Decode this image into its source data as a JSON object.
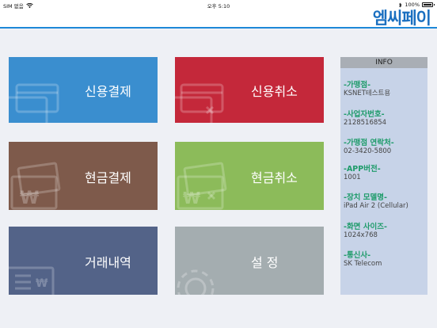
{
  "status_bar": {
    "carrier": "SIM 없음",
    "time": "오후 5:10",
    "battery": "100%"
  },
  "header": {
    "logo_text": "엠씨페이",
    "brand_color": "#1a6fc0"
  },
  "tiles": [
    {
      "label": "신용결제",
      "color": "#3a8ecf",
      "icon": "credit-card-icon"
    },
    {
      "label": "신용취소",
      "color": "#c4283a",
      "icon": "credit-card-cancel-icon"
    },
    {
      "label": "현금결제",
      "color": "#7e5a4b",
      "icon": "cash-won-icon"
    },
    {
      "label": "현금취소",
      "color": "#8cbb5a",
      "icon": "cash-won-cancel-icon"
    },
    {
      "label": "거래내역",
      "color": "#536388",
      "icon": "transaction-list-icon"
    },
    {
      "label": "설      정",
      "color": "#a4adb0",
      "icon": "gear-icon"
    }
  ],
  "info": {
    "title": "INFO",
    "items": [
      {
        "key": "-가맹점-",
        "value": "KSNET테스트용"
      },
      {
        "key": "-사업자번호-",
        "value": "2128516854"
      },
      {
        "key": "-가맹점 연락처-",
        "value": "02-3420-5800"
      },
      {
        "key": "-APP버전-",
        "value": "1001"
      },
      {
        "key": "-장치 모델명-",
        "value": "iPad Air 2 (Cellular)"
      },
      {
        "key": "-화면 사이즈-",
        "value": "1024x768"
      },
      {
        "key": "-통신사-",
        "value": "SK Telecom"
      }
    ]
  }
}
